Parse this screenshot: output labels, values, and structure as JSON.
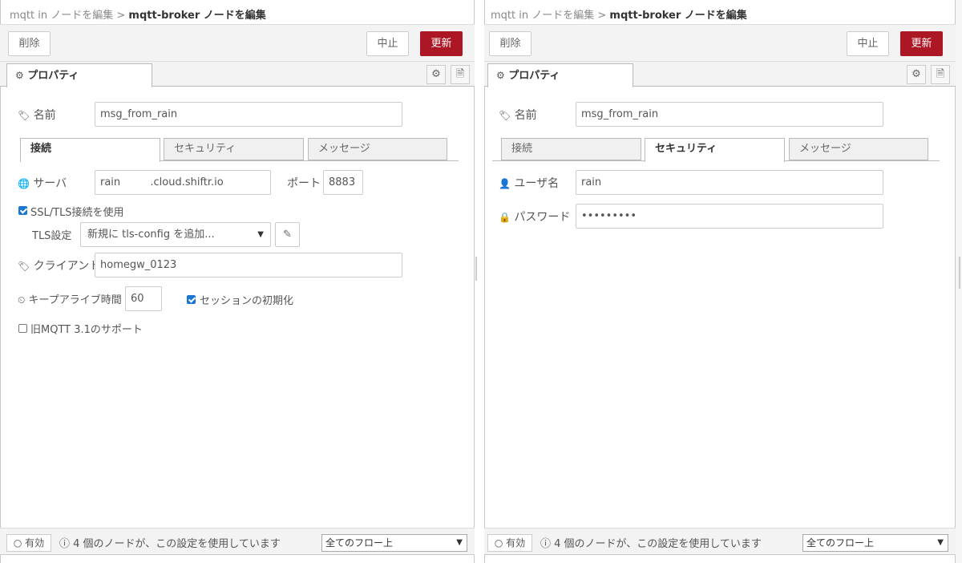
{
  "breadcrumb": {
    "parent": "mqtt in ノードを編集",
    "separator": ">",
    "current": "mqtt-broker ノードを編集"
  },
  "toolbar": {
    "delete_label": "削除",
    "cancel_label": "中止",
    "update_label": "更新"
  },
  "properties_tab": {
    "label": "プロパティ"
  },
  "left": {
    "name_label": "名前",
    "name_value": "msg_from_rain",
    "tabs": [
      "接続",
      "セキュリティ",
      "メッセージ"
    ],
    "active_tab": "接続",
    "server_label": "サーバ",
    "server_value": "rain         .cloud.shiftr.io",
    "port_label": "ポート",
    "port_value": "8883",
    "ssl_label": "SSL/TLS接続を使用",
    "ssl_checked": true,
    "tls_label": "TLS設定",
    "tls_value": "新規に tls-config を追加...",
    "client_label": "クライアント",
    "client_value": "homegw_0123",
    "keepalive_label": "キープアライブ時間",
    "keepalive_value": "60",
    "session_label": "セッションの初期化",
    "session_checked": true,
    "legacy_label": "旧MQTT 3.1のサポート",
    "legacy_checked": false
  },
  "right": {
    "name_label": "名前",
    "name_value": "msg_from_rain",
    "tabs": [
      "接続",
      "セキュリティ",
      "メッセージ"
    ],
    "active_tab": "セキュリティ",
    "user_label": "ユーザ名",
    "user_value": "rain",
    "password_label": "パスワード",
    "password_value": "•••••••••"
  },
  "footer": {
    "enabled_label": "有効",
    "usage_text": "4 個のノードが、この設定を使用しています",
    "scope_value": "全てのフロー上"
  },
  "colors": {
    "accent": "#ad1625",
    "checkbox": "#1976d2"
  },
  "icons": [
    "gear-icon",
    "document-icon",
    "tag-icon",
    "globe-icon",
    "pencil-icon",
    "clock-icon",
    "user-icon",
    "lock-icon",
    "info-icon",
    "circle-icon",
    "caret-down-icon"
  ]
}
